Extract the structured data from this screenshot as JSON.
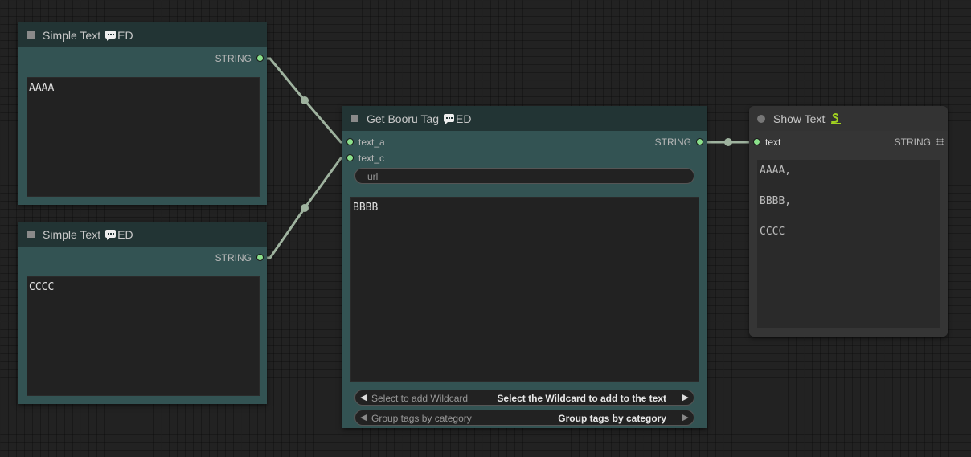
{
  "nodes": {
    "simple_text_1": {
      "title": "Simple Text",
      "badge": "ED",
      "output_label": "STRING",
      "text": "AAAA"
    },
    "simple_text_2": {
      "title": "Simple Text",
      "badge": "ED",
      "output_label": "STRING",
      "text": "CCCC"
    },
    "get_booru_tag": {
      "title": "Get Booru Tag",
      "badge": "ED",
      "inputs": [
        "text_a",
        "text_c"
      ],
      "output_label": "STRING",
      "url_field": "url",
      "text": "BBBB",
      "wildcard_select": {
        "label": "Select to add Wildcard",
        "value": "Select the Wildcard to add to the text"
      },
      "group_select": {
        "label": "Group tags by category",
        "value": "Group tags by category"
      }
    },
    "show_text": {
      "title": "Show Text",
      "input_label": "text",
      "output_label": "STRING",
      "text": "AAAA,\n\nBBBB,\n\nCCCC"
    }
  },
  "colors": {
    "canvas": "#222222",
    "node_title": "#223434",
    "node_body": "#335353",
    "link": "#9fb39f",
    "slot_dot": "#8be08b"
  },
  "icons": [
    "chat-bubble-icon",
    "snake-icon",
    "grid-icon",
    "triangle-left-icon",
    "triangle-right-icon"
  ]
}
